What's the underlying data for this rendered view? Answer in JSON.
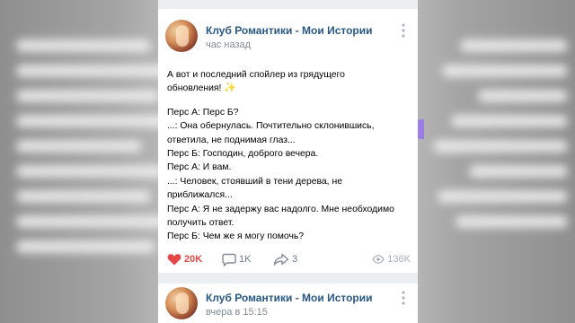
{
  "post1": {
    "group_name": "Клуб Романтики - Мои Истории",
    "time": "час назад",
    "text_lines": [
      "А вот и последний спойлер из грядущего",
      "обновления!",
      "",
      "Перс А: Перс Б?",
      "...: Она обернулась. Почтительно склонившись,",
      "ответила, не поднимая глаз...",
      "Перс Б: Господин, доброго вечера.",
      "Перс А: И вам.",
      "...: Человек, стоявший в тени дерева, не",
      "приближался...",
      "Перс А: Я не задержу вас надолго. Мне необходимо",
      "получить ответ.",
      "Перс Б: Чем же я могу помочь?"
    ],
    "likes": "20K",
    "comments": "1K",
    "reposts": "3",
    "views": "136K"
  },
  "post2": {
    "group_name": "Клуб Романтики - Мои Истории",
    "time": "вчера в 15:15"
  },
  "icons": {
    "more": "more-vertical-icon",
    "like": "heart-icon",
    "comment": "comment-icon",
    "share": "share-icon",
    "views": "eye-icon",
    "emoji": "sparkle-emoji"
  },
  "colors": {
    "link": "#2a5885",
    "meta": "#818c99",
    "like": "#e64646",
    "background": "#edeef0"
  }
}
